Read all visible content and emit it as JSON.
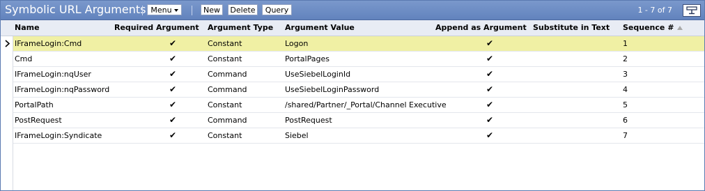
{
  "applet": {
    "title": "Symbolic URL Arguments",
    "menu_label": "Menu",
    "buttons": {
      "new": "New",
      "delete": "Delete",
      "query": "Query"
    },
    "record_count": "1 - 7 of 7"
  },
  "columns": [
    "Name",
    "Required Argument",
    "Argument Type",
    "Argument Value",
    "Append as Argument",
    "Substitute in Text",
    "Sequence #"
  ],
  "check_glyph": "✔",
  "rows": [
    {
      "name": "IFrameLogin:Cmd",
      "required": true,
      "type": "Constant",
      "value": "Logon",
      "append": true,
      "substitute": false,
      "sequence": "1",
      "selected": true
    },
    {
      "name": "Cmd",
      "required": true,
      "type": "Constant",
      "value": "PortalPages",
      "append": true,
      "substitute": false,
      "sequence": "2"
    },
    {
      "name": "IFrameLogin:nqUser",
      "required": true,
      "type": "Command",
      "value": "UseSiebelLoginId",
      "append": true,
      "substitute": false,
      "sequence": "3"
    },
    {
      "name": "IFrameLogin:nqPassword",
      "required": true,
      "type": "Command",
      "value": "UseSiebelLoginPassword",
      "append": true,
      "substitute": false,
      "sequence": "4"
    },
    {
      "name": "PortalPath",
      "required": true,
      "type": "Constant",
      "value": "/shared/Partner/_Portal/Channel Executive",
      "append": true,
      "substitute": false,
      "sequence": "5"
    },
    {
      "name": "PostRequest",
      "required": true,
      "type": "Command",
      "value": "PostRequest",
      "append": true,
      "substitute": false,
      "sequence": "6"
    },
    {
      "name": "IFrameLogin:Syndicate",
      "required": true,
      "type": "Constant",
      "value": "Siebel",
      "append": true,
      "substitute": false,
      "sequence": "7"
    }
  ]
}
